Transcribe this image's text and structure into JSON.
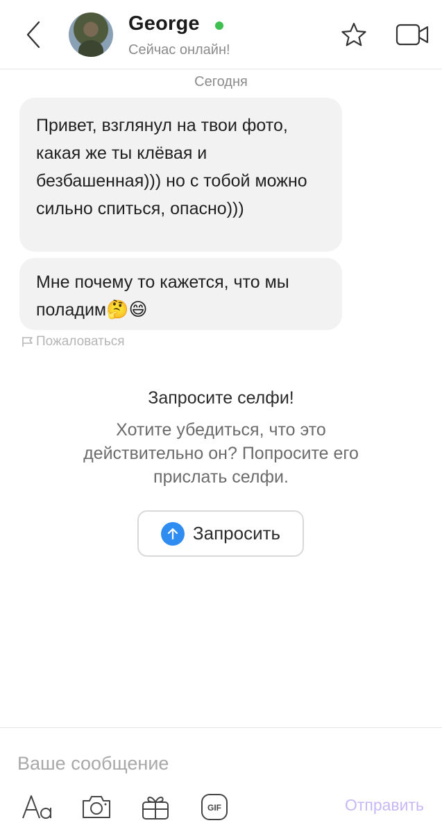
{
  "header": {
    "name": "George",
    "status": "Сейчас онлайн!",
    "online_color": "#3fbf4f",
    "icons": [
      "back-chevron-icon",
      "star-icon",
      "video-camera-icon"
    ]
  },
  "chat": {
    "date_label": "Сегодня",
    "messages": [
      {
        "text": "Привет, взглянул на твои фото, какая же ты клёвая и безбашенная))) но с тобой можно сильно спиться, опасно)))"
      },
      {
        "text": "Мне почему то кажется, что мы поладим",
        "emojis": "🤔😄"
      }
    ],
    "report_label": "Пожаловаться"
  },
  "selfie_request": {
    "title": "Запросите селфи!",
    "description": "Хотите убедиться, что это действительно он? Попросите его прислать селфи.",
    "button_label": "Запросить",
    "accent_color": "#2f8cf0"
  },
  "composer": {
    "placeholder": "Ваше сообщение",
    "value": "",
    "tools": [
      "font-icon",
      "camera-icon",
      "gift-icon",
      "gif-icon"
    ],
    "gif_label": "GIF",
    "send_label": "Отправить",
    "send_color": "#c7b8f5"
  }
}
